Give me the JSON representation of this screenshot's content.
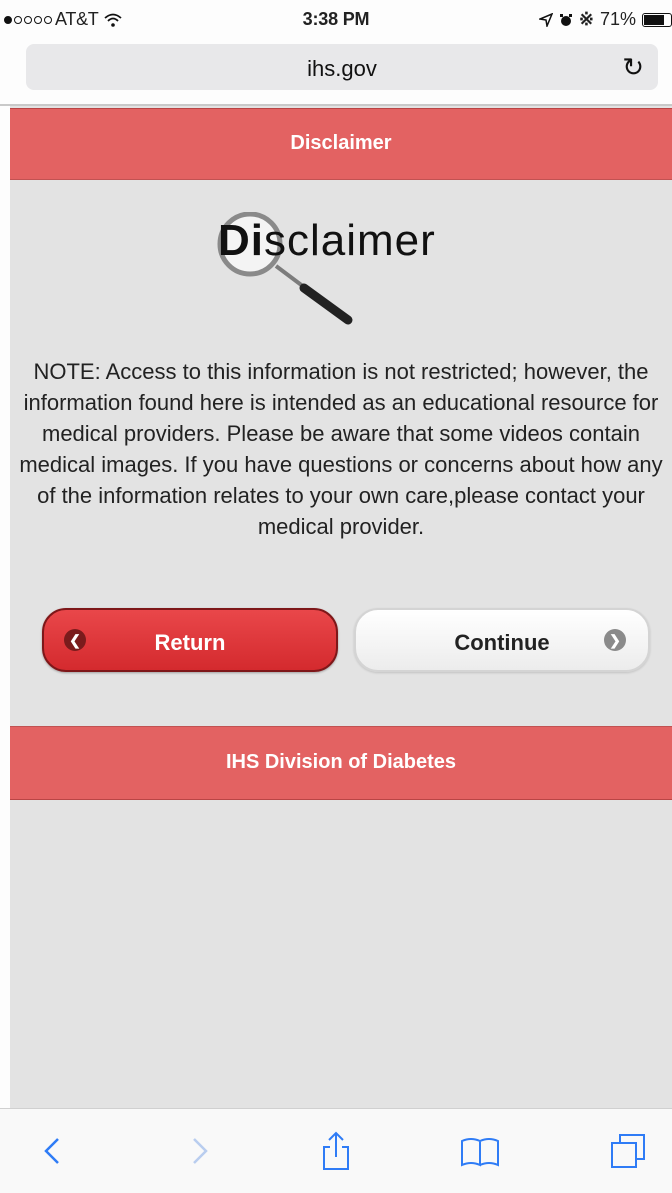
{
  "status_bar": {
    "carrier": "AT&T",
    "time": "3:38 PM",
    "battery": "71%"
  },
  "browser": {
    "domain": "ihs.gov",
    "reload_icon": "reload-icon"
  },
  "header": {
    "title": "Disclaimer"
  },
  "logo": {
    "bold_part": "Di",
    "rest_part": "sclaimer"
  },
  "notice": {
    "text": "NOTE: Access to this information is not restricted; however, the information found here is intended as an educational resource for medical providers. Please be aware that some videos contain medical images. If you have questions or concerns about how any of the information relates to your own care,please contact your medical provider."
  },
  "buttons": {
    "return_label": "Return",
    "continue_label": "Continue"
  },
  "footer": {
    "title": "IHS Division of Diabetes"
  },
  "colors": {
    "accent": "#e36262",
    "return_button": "#d42a2e",
    "toolbar_icon": "#2f7cf6"
  }
}
